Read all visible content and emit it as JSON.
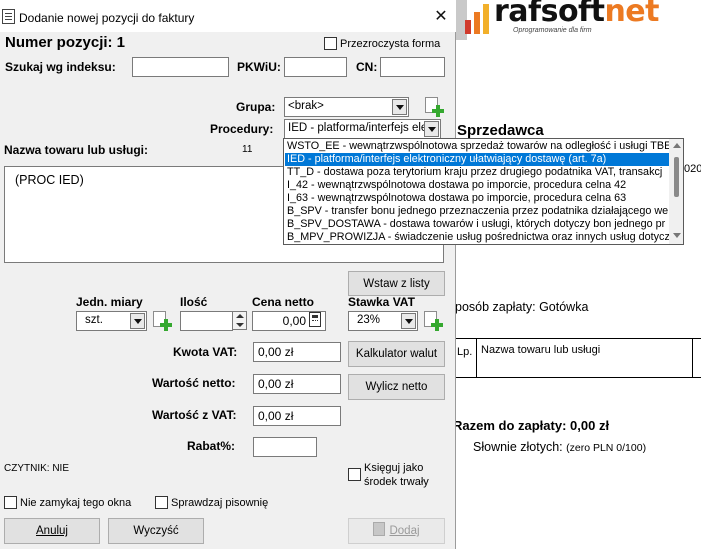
{
  "dialog": {
    "title": "Dodanie nowej pozycji do faktury",
    "close_glyph": "✕",
    "position_label": "Numer pozycji: 1",
    "transparent_form_label": "Przezroczysta forma",
    "search_index_label": "Szukaj wg indeksu:",
    "search_index_value": "",
    "pkwiu_label": "PKWiU:",
    "pkwiu_value": "",
    "cn_label": "CN:",
    "cn_value": "",
    "group_label": "Grupa:",
    "group_value": "<brak>",
    "procedures_label": "Procedury:",
    "procedures_value": "IED - platforma/interfejs elek",
    "product_name_label": "Nazwa towaru lub usługi:",
    "product_name_count": "11",
    "product_name_value": "(PROC IED)",
    "insert_list_button": "Wstaw z listy",
    "unit_label": "Jedn. miary",
    "unit_value": "szt.",
    "qty_label": "Ilość",
    "qty_value": "",
    "net_price_label": "Cena netto",
    "net_price_value": "0,00",
    "vat_rate_label": "Stawka VAT",
    "vat_rate_value": "23%",
    "vat_amount_label": "Kwota VAT:",
    "vat_amount_value": "0,00 zł",
    "vat_calc_button": "Kalkulator walut",
    "net_value_label": "Wartość netto:",
    "net_value_value": "0,00 zł",
    "compute_net_button": "Wylicz netto",
    "gross_value_label": "Wartość z VAT:",
    "gross_value_value": "0,00 zł",
    "discount_label": "Rabat%:",
    "discount_value": "",
    "reader_status": "CZYTNIK: NIE",
    "fixed_asset_label_1": "Księguj jako",
    "fixed_asset_label_2": "środek trwały",
    "keep_open_label": "Nie zamykaj tego okna",
    "spellcheck_label": "Sprawdzaj pisownię",
    "cancel_button": "Anuluj",
    "clear_button": "Wyczyść",
    "add_button": "Dodaj"
  },
  "procedures_dropdown": {
    "items": [
      "WSTO_EE - wewnątrzwspólnotowa sprzedaż towarów na odległość i usługi TBE",
      "IED - platforma/interfejs elektroniczny ułatwiający dostawę (art. 7a)",
      "TT_D - dostawa poza terytorium kraju przez drugiego podatnika VAT, transakcj",
      "I_42 - wewnątrzwspólnotowa dostawa po imporcie, procedura celna 42",
      "I_63 - wewnątrzwspólnotowa dostawa po imporcie, procedura celna 63",
      "B_SPV - transfer bonu jednego przeznaczenia przez podatnika działającego we",
      "B_SPV_DOSTAWA - dostawa towarów i usługi, których dotyczy bon jednego pr",
      "B_MPV_PROWIZJA - świadczenie usług pośrednictwa oraz innych usług dotycza"
    ],
    "selected_index": 1
  },
  "background_doc": {
    "logo_main": "rafsoft",
    "logo_accent": "net",
    "logo_tagline": "Oprogramowanie dla firm",
    "seller_heading": "Sprzedawca",
    "year_fragment": "020",
    "payment_line": "posób zapłaty: Gotówka",
    "table_col_lp": "Lp.",
    "table_col_name": "Nazwa towaru lub usługi",
    "total_line": "Razem do zapłaty: 0,00 zł",
    "words_label": "Słownie złotych:",
    "words_value": "(zero PLN 0/100)"
  },
  "colors": {
    "selection": "#0078d7",
    "logo_accent": "#ec7a22",
    "dialog_bg": "#f0f0f0"
  }
}
